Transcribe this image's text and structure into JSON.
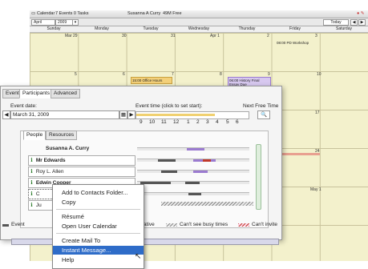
{
  "calendar": {
    "title": "Calendar",
    "counts": "7 Events 0 Tasks",
    "user": "Susanna A Curry",
    "free": "49M Free",
    "month": "April",
    "year": "2009",
    "today_label": "Today",
    "days": [
      "Sunday",
      "Monday",
      "Tuesday",
      "Wednesday",
      "Thursday",
      "Friday",
      "Saturday"
    ],
    "row1_dates": [
      "Mar 29",
      "30",
      "31",
      "Apr 1",
      "2",
      "3"
    ],
    "row2_dates": [
      "5",
      "6",
      "7",
      "8",
      "9",
      "10"
    ],
    "row3_dates": [
      "17"
    ],
    "row4_dates": [
      "24"
    ],
    "row5_dates": [
      "May 1"
    ],
    "events": {
      "friday_event": "08:00 PD Workshop",
      "tuesday_event": "15:00 Office Hours",
      "thursday_event": "06:00 History Final Essay Due"
    }
  },
  "dialog": {
    "tabs": [
      "Event",
      "Participants",
      "Advanced"
    ],
    "event_date_label": "Event date:",
    "event_date_value": "March 31, 2009",
    "event_time_label": "Event time (click to set start):",
    "next_free_time_label": "Next Free Time",
    "hours": [
      "9",
      "10",
      "11",
      "12",
      "1",
      "2",
      "3",
      "4",
      "5",
      "6"
    ],
    "people_tabs": [
      "People",
      "Resources"
    ],
    "participants": [
      "Susanna A. Curry",
      "Mr Edwards",
      "Roy L. Allen",
      "Edwin Cooper",
      "C",
      "Ju"
    ],
    "legend": {
      "event": "Event",
      "tentative": "ative",
      "cant_see": "Can't see busy times",
      "cant_invite": "Can't invite"
    }
  },
  "context_menu": {
    "items": [
      "Add to Contacts Folder...",
      "Copy",
      "Résumé",
      "Open User Calendar",
      "Create Mail To",
      "Instant Message...",
      "Help"
    ],
    "highlighted": "Instant Message..."
  },
  "colors": {
    "accent": "#2e6cc8",
    "calendar_bg": "#f3f1cc",
    "busy": "#555555",
    "tentative": "#9b7bd0",
    "cant_invite": "#c0392b"
  }
}
